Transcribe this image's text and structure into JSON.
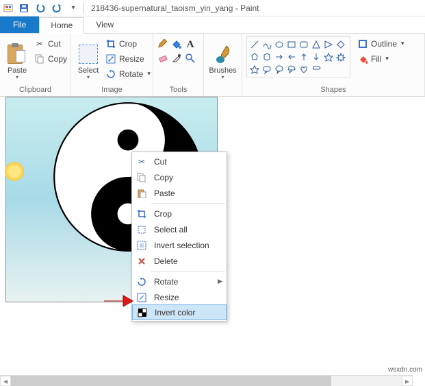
{
  "title": "218436-supernatural_taoism_yin_yang - Paint",
  "tabs": {
    "file": "File",
    "home": "Home",
    "view": "View"
  },
  "ribbon": {
    "clipboard": {
      "label": "Clipboard",
      "paste": "Paste",
      "cut": "Cut",
      "copy": "Copy"
    },
    "image": {
      "label": "Image",
      "select": "Select",
      "crop": "Crop",
      "resize": "Resize",
      "rotate": "Rotate"
    },
    "tools": {
      "label": "Tools"
    },
    "brushes": {
      "label": "Brushes"
    },
    "shapes": {
      "label": "Shapes",
      "outline": "Outline",
      "fill": "Fill"
    }
  },
  "ctx": {
    "cut": "Cut",
    "copy": "Copy",
    "paste": "Paste",
    "crop": "Crop",
    "select_all": "Select all",
    "invert_selection": "Invert selection",
    "delete": "Delete",
    "rotate": "Rotate",
    "resize": "Resize",
    "invert_color": "Invert color"
  },
  "watermark": "wsxdn.com"
}
